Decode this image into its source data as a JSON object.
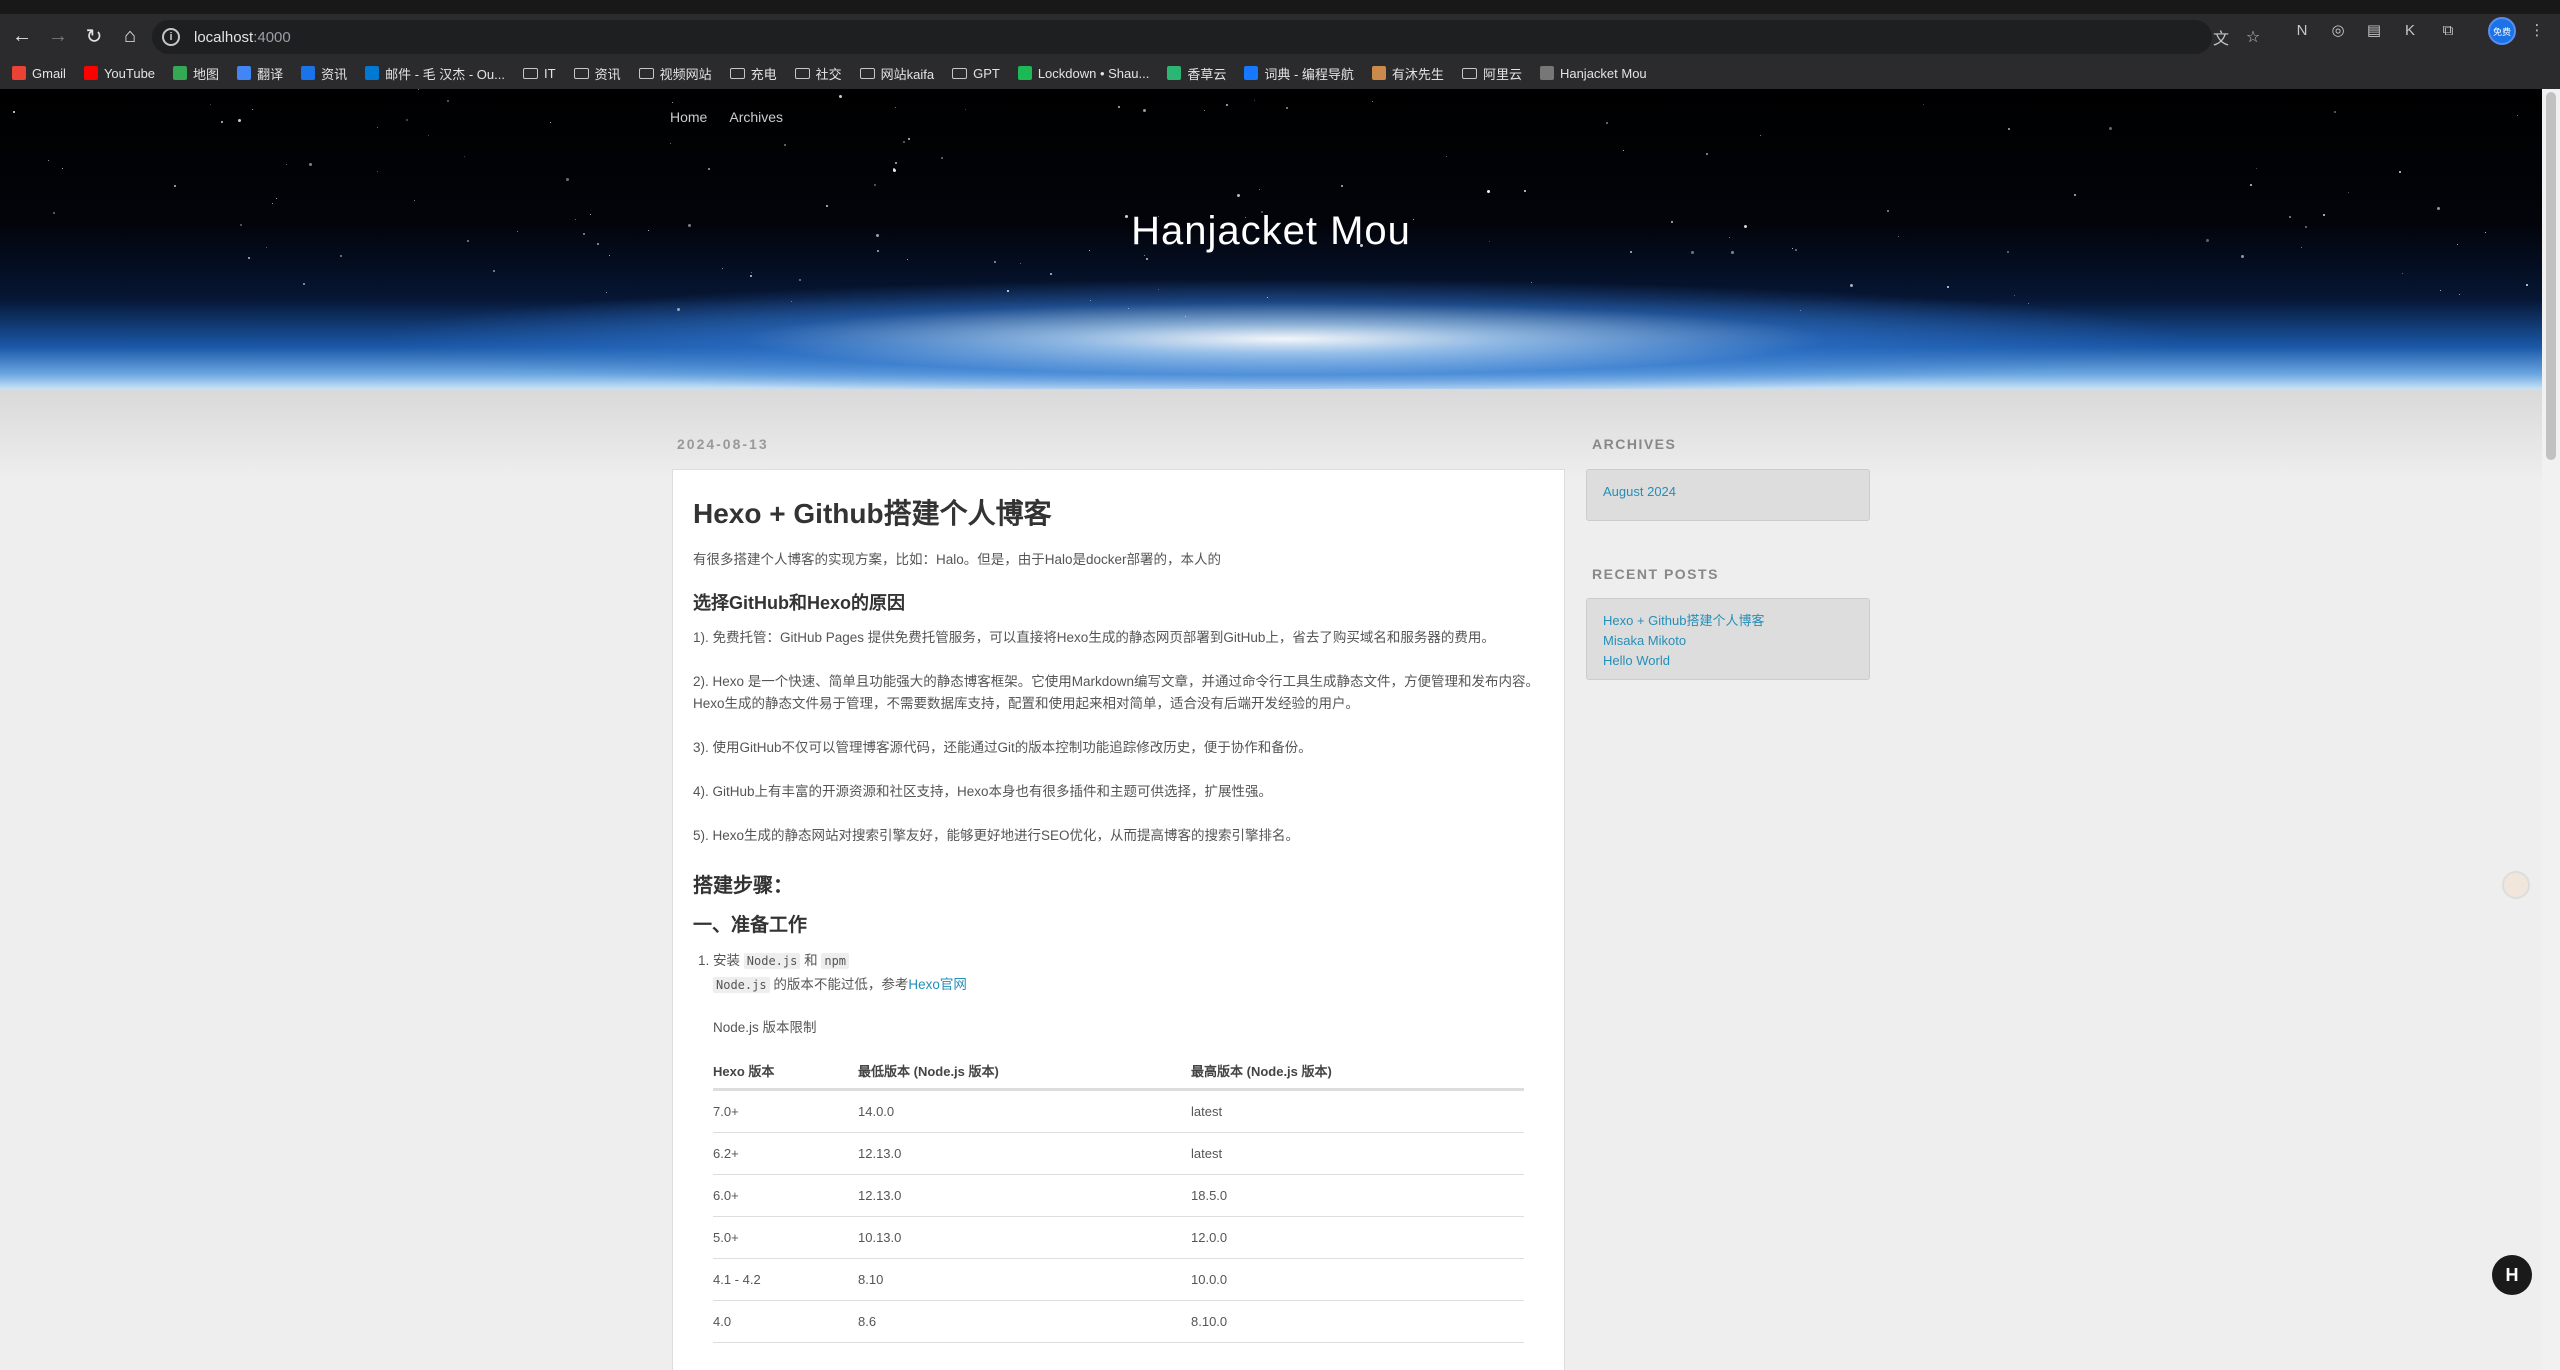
{
  "browser": {
    "url_host": "localhost",
    "url_port": ":4000",
    "bookmarks": [
      {
        "label": "Gmail",
        "icon": "gmail-icon",
        "color": "#ea4335"
      },
      {
        "label": "YouTube",
        "icon": "youtube-icon",
        "color": "#ff0000"
      },
      {
        "label": "地图",
        "icon": "maps-icon",
        "color": "#34a853"
      },
      {
        "label": "翻译",
        "icon": "translate-icon",
        "color": "#4285f4"
      },
      {
        "label": "资讯",
        "icon": "news-icon",
        "color": "#1a73e8"
      },
      {
        "label": "邮件 - 毛 汉杰 - Ou...",
        "icon": "outlook-icon",
        "color": "#0078d4"
      },
      {
        "label": "IT",
        "icon": "folder-icon"
      },
      {
        "label": "资讯",
        "icon": "folder-icon"
      },
      {
        "label": "视频网站",
        "icon": "folder-icon"
      },
      {
        "label": "充电",
        "icon": "folder-icon"
      },
      {
        "label": "社交",
        "icon": "folder-icon"
      },
      {
        "label": "网站kaifa",
        "icon": "folder-icon"
      },
      {
        "label": "GPT",
        "icon": "folder-icon"
      },
      {
        "label": "Lockdown • Shau...",
        "icon": "spotify-icon",
        "color": "#1db954"
      },
      {
        "label": "香草云",
        "icon": "cloud-icon",
        "color": "#2bb673"
      },
      {
        "label": "词典 - 编程导航",
        "icon": "dictionary-icon",
        "color": "#1677ff"
      },
      {
        "label": "有沐先生",
        "icon": "avatar-icon",
        "color": "#c98a4b"
      },
      {
        "label": "阿里云",
        "icon": "folder-icon"
      },
      {
        "label": "Hanjacket Mou",
        "icon": "globe-icon"
      }
    ],
    "profile_label": "免费"
  },
  "site": {
    "title": "Hanjacket Mou",
    "nav": [
      "Home",
      "Archives"
    ]
  },
  "post": {
    "date": "2024-08-13",
    "title": "Hexo + Github搭建个人博客",
    "intro": "有很多搭建个人博客的实现方案，比如：Halo。但是，由于Halo是docker部署的，本人的",
    "h_reason": "选择GitHub和Hexo的原因",
    "r1": "1). 免费托管：GitHub Pages 提供免费托管服务，可以直接将Hexo生成的静态网页部署到GitHub上，省去了购买域名和服务器的费用。",
    "r2a": "2). Hexo 是一个快速、简单且功能强大的静态博客框架。它使用Markdown编写文章，并通过命令行工具生成静态文件，方便管理和发布内容。",
    "r2b": "Hexo生成的静态文件易于管理，不需要数据库支持，配置和使用起来相对简单，适合没有后端开发经验的用户。",
    "r3": "3). 使用GitHub不仅可以管理博客源代码，还能通过Git的版本控制功能追踪修改历史，便于协作和备份。",
    "r4": "4). GitHub上有丰富的开源资源和社区支持，Hexo本身也有很多插件和主题可供选择，扩展性强。",
    "r5": "5). Hexo生成的静态网站对搜索引擎友好，能够更好地进行SEO优化，从而提高博客的搜索引擎排名。",
    "h_steps": "搭建步骤：",
    "h_prep": "一、准备工作",
    "li1_pre": "安装 ",
    "li1_code1": "Node.js",
    "li1_mid": " 和 ",
    "li1_code2": "npm",
    "li1b_code": "Node.js",
    "li1b_text": " 的版本不能过低，参考",
    "li1b_link": "Hexo官网",
    "table_caption": "Node.js 版本限制",
    "table_headers": [
      "Hexo 版本",
      "最低版本 (Node.js 版本)",
      "最高版本 (Node.js 版本)"
    ],
    "table_rows": [
      [
        "7.0+",
        "14.0.0",
        "latest"
      ],
      [
        "6.2+",
        "12.13.0",
        "latest"
      ],
      [
        "6.0+",
        "12.13.0",
        "18.5.0"
      ],
      [
        "5.0+",
        "10.13.0",
        "12.0.0"
      ],
      [
        "4.1 - 4.2",
        "8.10",
        "10.0.0"
      ],
      [
        "4.0",
        "8.6",
        "8.10.0"
      ]
    ]
  },
  "sidebar": {
    "archives_title": "ARCHIVES",
    "archives": [
      "August 2024"
    ],
    "recent_title": "RECENT POSTS",
    "recent": [
      "Hexo + Github搭建个人博客",
      "Misaka Mikoto",
      "Hello World"
    ]
  },
  "hexo_button": "H"
}
